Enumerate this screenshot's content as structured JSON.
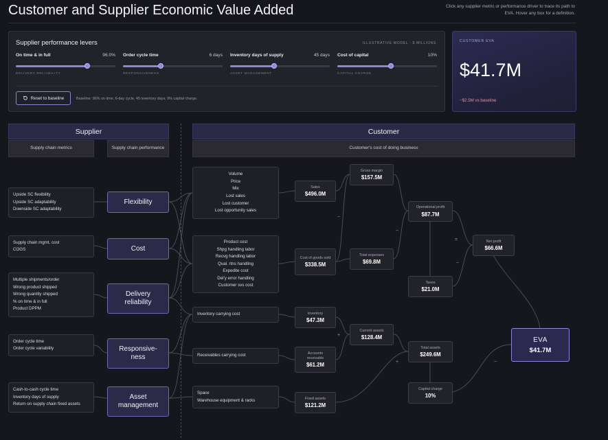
{
  "header": {
    "title": "Customer and Supplier Economic Value Added",
    "hint": "Click any supplier metric or performance driver to trace its path to EVA. Hover any box for a definition."
  },
  "levers_panel": {
    "title": "Supplier performance levers",
    "tag": "ILLUSTRATIVE MODEL · $ MILLIONS",
    "levers": [
      {
        "name": "On time & in full",
        "value": "96.0%",
        "sub": "DELIVERY RELIABILITY",
        "level_pct": 72
      },
      {
        "name": "Order cycle time",
        "value": "6 days",
        "sub": "RESPONSIVENESS",
        "level_pct": 38
      },
      {
        "name": "Inventory days of supply",
        "value": "45 days",
        "sub": "ASSET MANAGEMENT",
        "level_pct": 44
      },
      {
        "name": "Cost of capital",
        "value": "10%",
        "sub": "CAPITAL CHARGE",
        "level_pct": 54
      }
    ],
    "reset_label": "Reset to baseline",
    "baseline_text": "Baseline: 96% on time, 6-day cycle, 45 inventory days, 9% capital charge."
  },
  "eva_card": {
    "label": "CUSTOMER EVA",
    "value": "$41.7M",
    "delta": "−$2.5M vs baseline"
  },
  "supplier": {
    "header": "Supplier",
    "metrics_header": "Supply chain metrics",
    "performance_header": "Supply chain performance",
    "metrics": [
      [
        "Upside SC flexibility",
        "Upside SC adaptability",
        "Downside SC adaptability"
      ],
      [
        "Supply chain mgmt. cost",
        "COGS"
      ],
      [
        "Multiple shipments/order",
        "Wrong product shipped",
        "Wrong quantity shipped",
        "% on time & in full",
        "Product DPPM"
      ],
      [
        "Order cycle time",
        "Order cycle variability"
      ],
      [
        "Cash-to-cash cycle time",
        "Inventory days of supply",
        "Return on supply chain fixed assets"
      ]
    ],
    "performance": [
      "Flexibility",
      "Cost",
      "Delivery reliability",
      "Responsive-ness",
      "Asset management"
    ]
  },
  "customer": {
    "header": "Customer",
    "subheader": "Customer's cost of doing business",
    "drivers": {
      "revenue": [
        "Volume",
        "Price",
        "Mix",
        "Lost sales",
        "Lost customer",
        "Lost opportunity sales"
      ],
      "costs": [
        "Product cost",
        "Shpg handling labor",
        "Recvg handling labor",
        "Qual. rtns handling",
        "Expedite cost",
        "Del'y error handling",
        "Customer svs cost"
      ],
      "inventory": "Inventory carrying cost",
      "receivables": "Receivables carrying cost",
      "fixed": [
        "Space",
        "Warehouse equipment & racks"
      ]
    },
    "financials": {
      "sales": {
        "label": "Sales",
        "value": "$496.0M"
      },
      "cogs": {
        "label": "Cost of goods sold",
        "value": "$338.5M"
      },
      "inventory": {
        "label": "Inventory",
        "value": "$47.3M"
      },
      "receivables": {
        "label": "Accounts receivable",
        "value": "$61.2M"
      },
      "fixed_assets": {
        "label": "Fixed assets",
        "value": "$121.2M"
      },
      "gross_margin": {
        "label": "Gross margin",
        "value": "$157.5M"
      },
      "total_expenses": {
        "label": "Total expenses",
        "value": "$69.8M"
      },
      "current_assets": {
        "label": "Current assets",
        "value": "$128.4M"
      },
      "operational_profit": {
        "label": "Operational profit",
        "value": "$87.7M"
      },
      "taxes": {
        "label": "Taxes",
        "value": "$21.0M"
      },
      "total_assets": {
        "label": "Total assets",
        "value": "$249.6M"
      },
      "capital_charge": {
        "label": "Capital charge",
        "value": "10%"
      },
      "net_profit": {
        "label": "Net profit",
        "value": "$66.6M"
      },
      "eva": {
        "label": "EVA",
        "value": "$41.7M"
      }
    },
    "operators": {
      "minus": "−",
      "plus": "+",
      "equals": "="
    }
  },
  "colors": {
    "accent": "#8a86d8",
    "negative": "#e98c9a",
    "background": "#16161d"
  }
}
